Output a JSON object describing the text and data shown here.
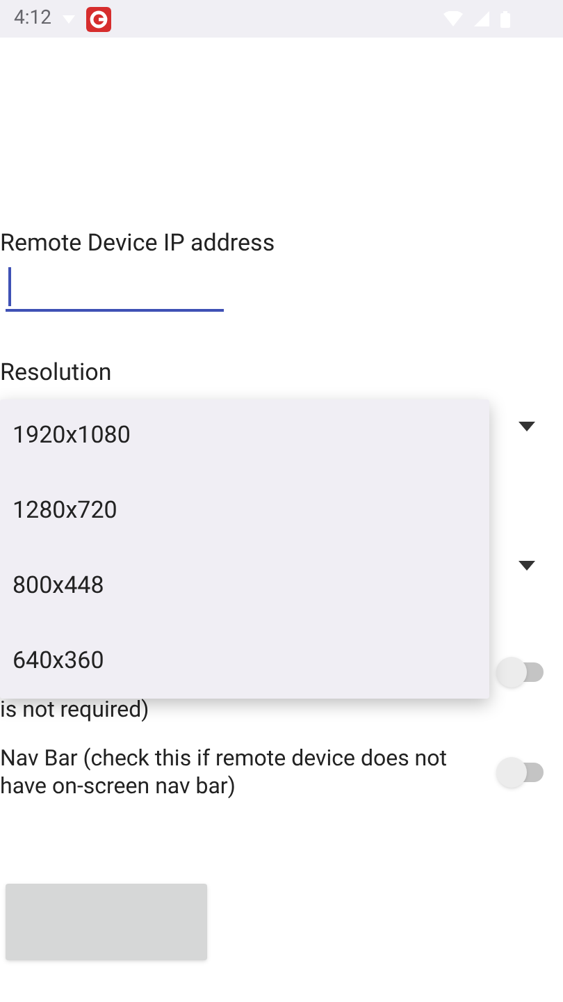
{
  "status_bar": {
    "time": "4:12"
  },
  "ip_field": {
    "label": "Remote Device IP address",
    "focused": true
  },
  "resolution": {
    "label": "Resolution"
  },
  "dropdown": {
    "options": [
      "1920x1080",
      "1280x720",
      "800x448",
      "640x360"
    ]
  },
  "switches": [
    {
      "label": "is not required)",
      "on": false
    },
    {
      "label": "Nav Bar (check this if remote device does not have on-screen nav bar)",
      "on": false
    }
  ]
}
